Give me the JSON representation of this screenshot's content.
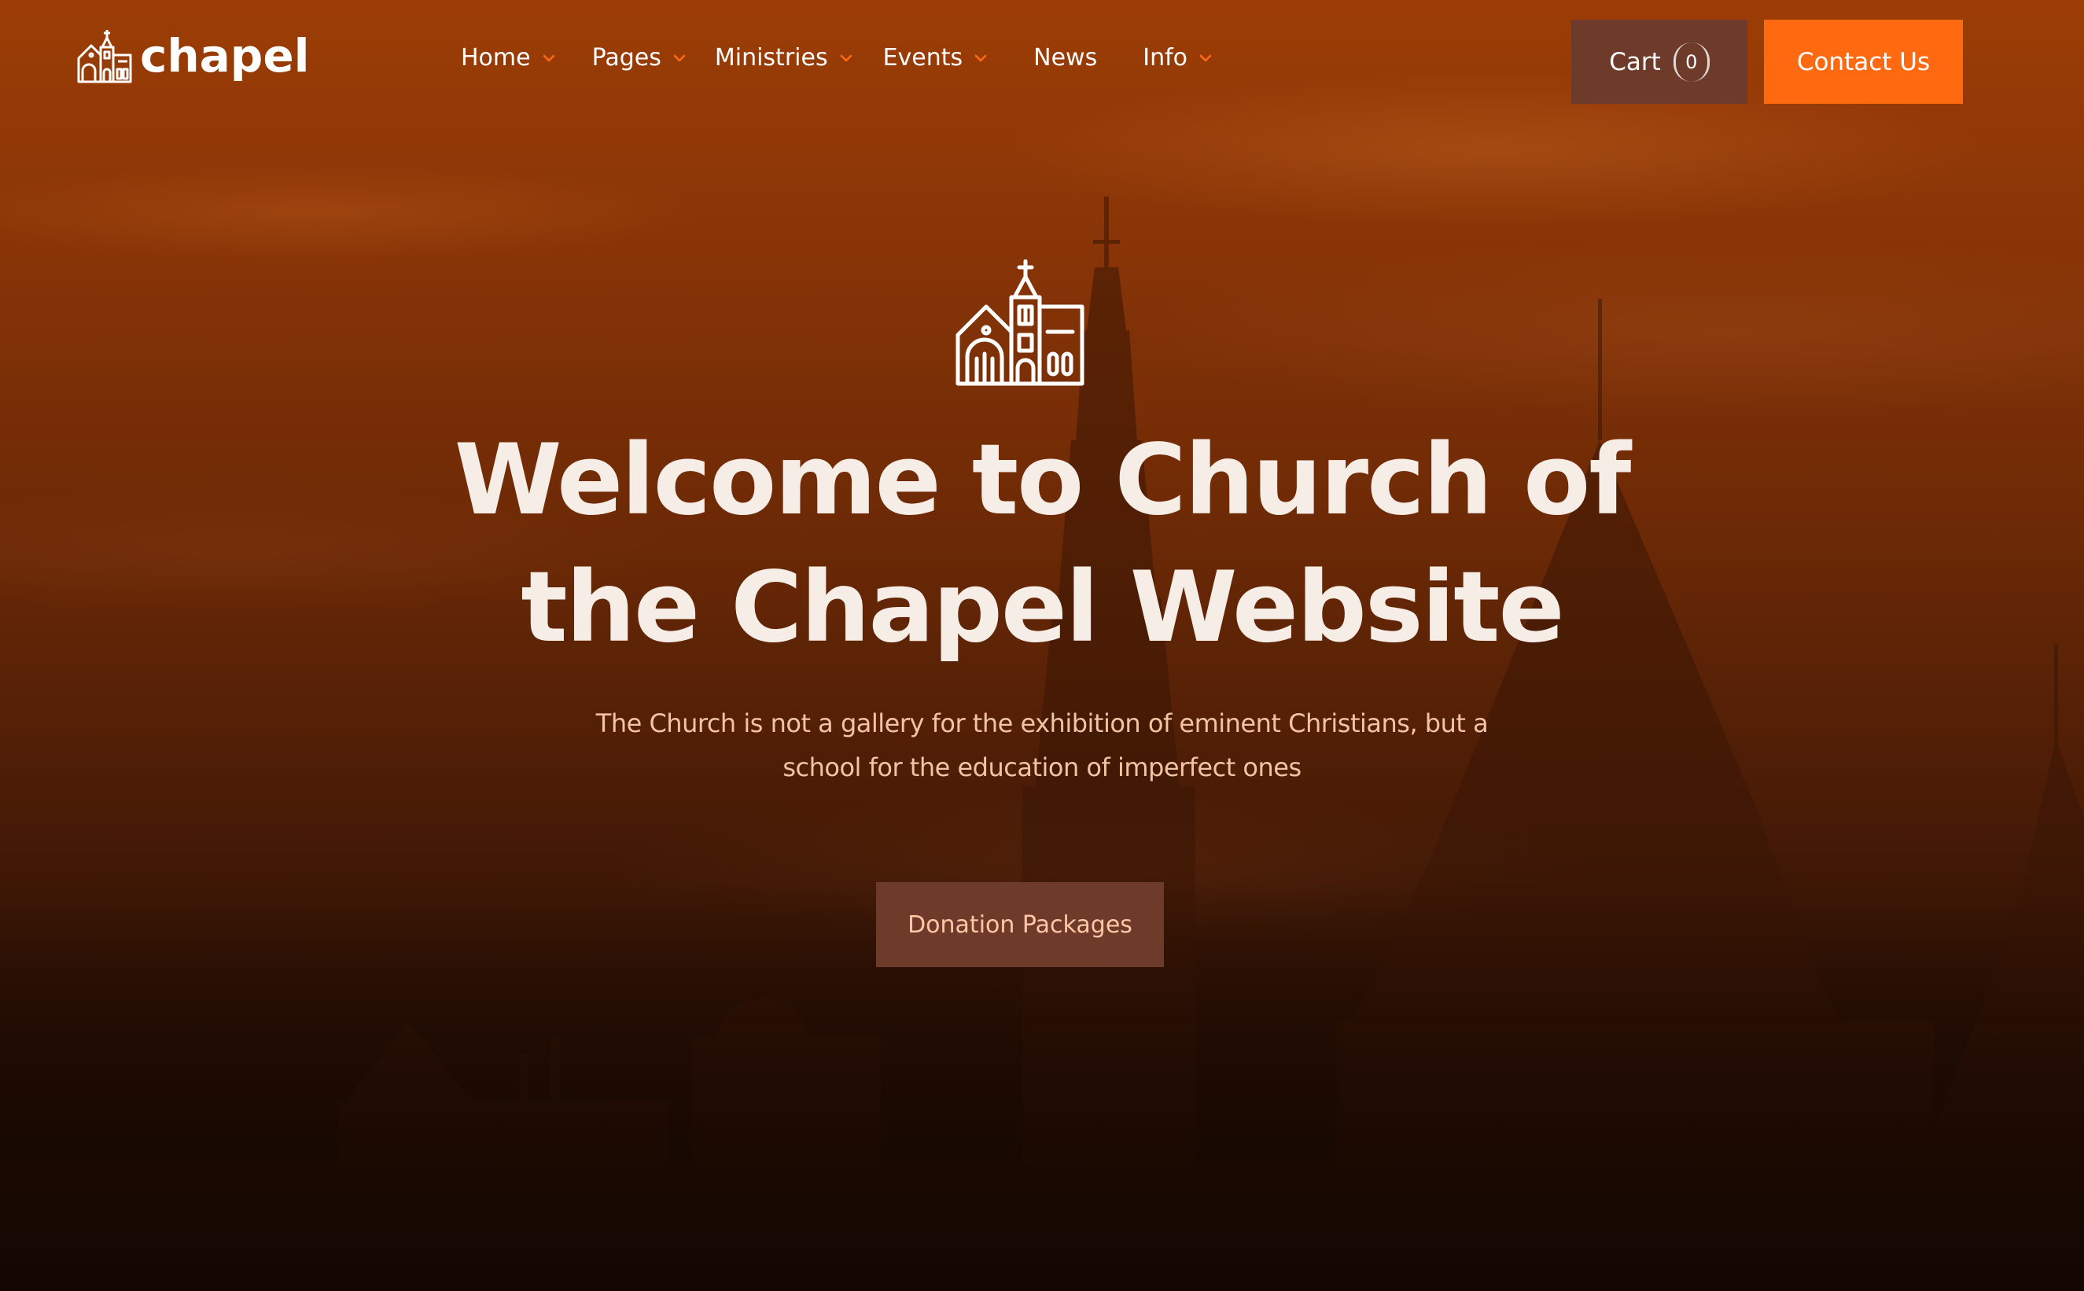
{
  "brand": {
    "name": "chapel",
    "logo_icon": "church-icon"
  },
  "nav": {
    "items": [
      {
        "label": "Home",
        "has_dropdown": true
      },
      {
        "label": "Pages",
        "has_dropdown": true
      },
      {
        "label": "Ministries",
        "has_dropdown": true
      },
      {
        "label": "Events",
        "has_dropdown": true
      },
      {
        "label": "News",
        "has_dropdown": false
      },
      {
        "label": "Info",
        "has_dropdown": true
      }
    ]
  },
  "header": {
    "cart_label": "Cart",
    "cart_count": "0",
    "contact_label": "Contact Us"
  },
  "hero": {
    "icon": "church-icon",
    "title_line1": "Welcome to Church of",
    "title_line2": "the Chapel Website",
    "subtitle_line1": "The Church is not a gallery for the exhibition of eminent Christians, but a",
    "subtitle_line2": "school for the education of imperfect ones",
    "cta_label": "Donation Packages"
  },
  "colors": {
    "accent": "#ff6a10",
    "dark_button": "#6e3b2b",
    "chevron": "#ff6a10",
    "title_text": "#f6ede6",
    "subtitle_text": "#f2c4a4",
    "cta_text": "#ffc7a6"
  }
}
